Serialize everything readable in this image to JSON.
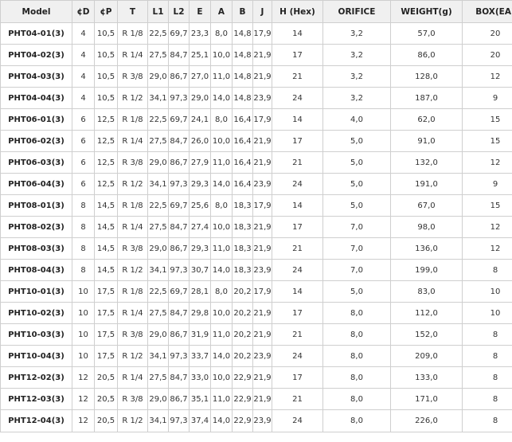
{
  "table": {
    "headers": [
      "Model",
      "¢D",
      "¢P",
      "T",
      "L1",
      "L2",
      "E",
      "A",
      "B",
      "J",
      "H (Hex)",
      "ORIFICE",
      "WEIGHT(g)",
      "BOX(EA)"
    ],
    "rows": [
      [
        "PHT04-01(3)",
        "4",
        "10,5",
        "R 1/8",
        "22,5",
        "69,7",
        "23,3",
        "8,0",
        "14,8",
        "17,9",
        "14",
        "3,2",
        "57,0",
        "20"
      ],
      [
        "PHT04-02(3)",
        "4",
        "10,5",
        "R 1/4",
        "27,5",
        "84,7",
        "25,1",
        "10,0",
        "14,8",
        "21,9",
        "17",
        "3,2",
        "86,0",
        "20"
      ],
      [
        "PHT04-03(3)",
        "4",
        "10,5",
        "R 3/8",
        "29,0",
        "86,7",
        "27,0",
        "11,0",
        "14,8",
        "21,9",
        "21",
        "3,2",
        "128,0",
        "12"
      ],
      [
        "PHT04-04(3)",
        "4",
        "10,5",
        "R 1/2",
        "34,1",
        "97,3",
        "29,0",
        "14,0",
        "14,8",
        "23,9",
        "24",
        "3,2",
        "187,0",
        "9"
      ],
      [
        "PHT06-01(3)",
        "6",
        "12,5",
        "R 1/8",
        "22,5",
        "69,7",
        "24,1",
        "8,0",
        "16,4",
        "17,9",
        "14",
        "4,0",
        "62,0",
        "15"
      ],
      [
        "PHT06-02(3)",
        "6",
        "12,5",
        "R 1/4",
        "27,5",
        "84,7",
        "26,0",
        "10,0",
        "16,4",
        "21,9",
        "17",
        "5,0",
        "91,0",
        "15"
      ],
      [
        "PHT06-03(3)",
        "6",
        "12,5",
        "R 3/8",
        "29,0",
        "86,7",
        "27,9",
        "11,0",
        "16,4",
        "21,9",
        "21",
        "5,0",
        "132,0",
        "12"
      ],
      [
        "PHT06-04(3)",
        "6",
        "12,5",
        "R 1/2",
        "34,1",
        "97,3",
        "29,3",
        "14,0",
        "16,4",
        "23,9",
        "24",
        "5,0",
        "191,0",
        "9"
      ],
      [
        "PHT08-01(3)",
        "8",
        "14,5",
        "R 1/8",
        "22,5",
        "69,7",
        "25,6",
        "8,0",
        "18,3",
        "17,9",
        "14",
        "5,0",
        "67,0",
        "15"
      ],
      [
        "PHT08-02(3)",
        "8",
        "14,5",
        "R 1/4",
        "27,5",
        "84,7",
        "27,4",
        "10,0",
        "18,3",
        "21,9",
        "17",
        "7,0",
        "98,0",
        "12"
      ],
      [
        "PHT08-03(3)",
        "8",
        "14,5",
        "R 3/8",
        "29,0",
        "86,7",
        "29,3",
        "11,0",
        "18,3",
        "21,9",
        "21",
        "7,0",
        "136,0",
        "12"
      ],
      [
        "PHT08-04(3)",
        "8",
        "14,5",
        "R 1/2",
        "34,1",
        "97,3",
        "30,7",
        "14,0",
        "18,3",
        "23,9",
        "24",
        "7,0",
        "199,0",
        "8"
      ],
      [
        "PHT10-01(3)",
        "10",
        "17,5",
        "R 1/8",
        "22,5",
        "69,7",
        "28,1",
        "8,0",
        "20,2",
        "17,9",
        "14",
        "5,0",
        "83,0",
        "10"
      ],
      [
        "PHT10-02(3)",
        "10",
        "17,5",
        "R 1/4",
        "27,5",
        "84,7",
        "29,8",
        "10,0",
        "20,2",
        "21,9",
        "17",
        "8,0",
        "112,0",
        "10"
      ],
      [
        "PHT10-03(3)",
        "10",
        "17,5",
        "R 3/8",
        "29,0",
        "86,7",
        "31,9",
        "11,0",
        "20,2",
        "21,9",
        "21",
        "8,0",
        "152,0",
        "8"
      ],
      [
        "PHT10-04(3)",
        "10",
        "17,5",
        "R 1/2",
        "34,1",
        "97,3",
        "33,7",
        "14,0",
        "20,2",
        "23,9",
        "24",
        "8,0",
        "209,0",
        "8"
      ],
      [
        "PHT12-02(3)",
        "12",
        "20,5",
        "R 1/4",
        "27,5",
        "84,7",
        "33,0",
        "10,0",
        "22,9",
        "21,9",
        "17",
        "8,0",
        "133,0",
        "8"
      ],
      [
        "PHT12-03(3)",
        "12",
        "20,5",
        "R 3/8",
        "29,0",
        "86,7",
        "35,1",
        "11,0",
        "22,9",
        "21,9",
        "21",
        "8,0",
        "171,0",
        "8"
      ],
      [
        "PHT12-04(3)",
        "12",
        "20,5",
        "R 1/2",
        "34,1",
        "97,3",
        "37,4",
        "14,0",
        "22,9",
        "23,9",
        "24",
        "8,0",
        "226,0",
        "8"
      ]
    ]
  }
}
